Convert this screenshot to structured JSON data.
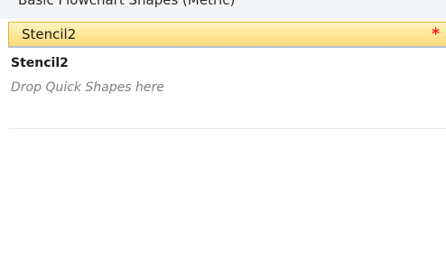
{
  "previous_stencil": {
    "label": "Basic Flowchart Shapes (Metric)"
  },
  "stencil": {
    "header_label": "Stencil2",
    "modified_marker": "*",
    "title": "Stencil2",
    "drop_hint": "Drop Quick Shapes here"
  },
  "colors": {
    "header_gradient_top": "#fff3c4",
    "header_gradient_bottom": "#fcd97a",
    "header_border": "#e3b13c",
    "modified_marker": "#ff1a1a",
    "hint_text": "#7f7f7f"
  }
}
